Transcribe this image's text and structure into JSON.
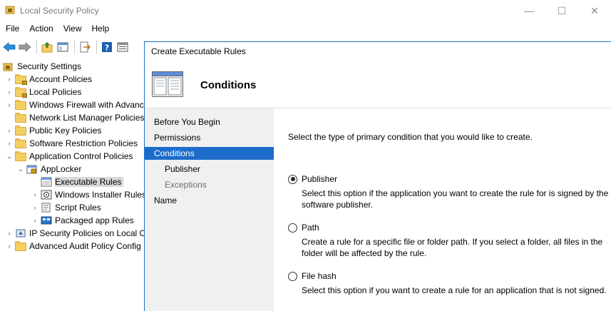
{
  "window": {
    "title": "Local Security Policy",
    "min_glyph": "—",
    "max_glyph": "☐",
    "close_glyph": "✕"
  },
  "menu": [
    "File",
    "Action",
    "View",
    "Help"
  ],
  "toolbar_icons": [
    "back-arrow-icon",
    "forward-arrow-icon",
    "up-folder-icon",
    "show-hide-tree-icon",
    "export-list-icon",
    "help-icon",
    "properties-icon"
  ],
  "tree": {
    "items": [
      {
        "label": "Security Settings",
        "expander": "",
        "depth": 0,
        "icon": "security-settings-icon"
      },
      {
        "label": "Account Policies",
        "expander": "›",
        "depth": 1,
        "icon": "folder-lock-icon"
      },
      {
        "label": "Local Policies",
        "expander": "›",
        "depth": 1,
        "icon": "folder-lock-icon"
      },
      {
        "label": "Windows Firewall with Advanc",
        "expander": "›",
        "depth": 1,
        "icon": "folder-icon"
      },
      {
        "label": "Network List Manager Policies",
        "expander": "",
        "depth": 1,
        "icon": "folder-icon"
      },
      {
        "label": "Public Key Policies",
        "expander": "›",
        "depth": 1,
        "icon": "folder-icon"
      },
      {
        "label": "Software Restriction Policies",
        "expander": "›",
        "depth": 1,
        "icon": "folder-icon"
      },
      {
        "label": "Application Control Policies",
        "expander": "⌄",
        "depth": 1,
        "icon": "folder-icon"
      },
      {
        "label": "AppLocker",
        "expander": "⌄",
        "depth": 2,
        "icon": "applocker-icon"
      },
      {
        "label": "Executable Rules",
        "expander": "",
        "depth": 3,
        "icon": "rules-list-icon",
        "selected": true
      },
      {
        "label": "Windows Installer Rules",
        "expander": "›",
        "depth": 3,
        "icon": "installer-icon"
      },
      {
        "label": "Script Rules",
        "expander": "›",
        "depth": 3,
        "icon": "script-icon"
      },
      {
        "label": "Packaged app Rules",
        "expander": "›",
        "depth": 3,
        "icon": "packaged-app-icon"
      },
      {
        "label": "IP Security Policies on Local Co",
        "expander": "›",
        "depth": 1,
        "icon": "ip-security-icon"
      },
      {
        "label": "Advanced Audit Policy Config",
        "expander": "›",
        "depth": 1,
        "icon": "folder-icon"
      }
    ]
  },
  "dialog": {
    "title": "Create Executable Rules",
    "header_title": "Conditions",
    "steps": [
      {
        "label": "Before You Begin",
        "state": "normal",
        "sub": false
      },
      {
        "label": "Permissions",
        "state": "normal",
        "sub": false
      },
      {
        "label": "Conditions",
        "state": "active",
        "sub": false
      },
      {
        "label": "Publisher",
        "state": "normal",
        "sub": true
      },
      {
        "label": "Exceptions",
        "state": "dim",
        "sub": true
      },
      {
        "label": "Name",
        "state": "normal",
        "sub": false
      }
    ],
    "prompt": "Select the type of primary condition that you would like to create.",
    "options": [
      {
        "label": "Publisher",
        "checked": true,
        "desc1": "Select this option if the application you want to create the rule for is signed by the",
        "desc2": "software publisher."
      },
      {
        "label": "Path",
        "checked": false,
        "desc1": "Create a rule for a specific file or folder path. If you select a folder, all files in the",
        "desc2": "folder will be affected by the rule."
      },
      {
        "label": "File hash",
        "checked": false,
        "desc1": "Select this option if you want to create a rule for an application that is not signed.",
        "desc2": ""
      }
    ]
  },
  "colors": {
    "selection_blue": "#1d6ccb",
    "dialog_border": "#1a73c6",
    "panel_gray": "#f0f0f0",
    "tree_selected": "#d9d9d9"
  }
}
